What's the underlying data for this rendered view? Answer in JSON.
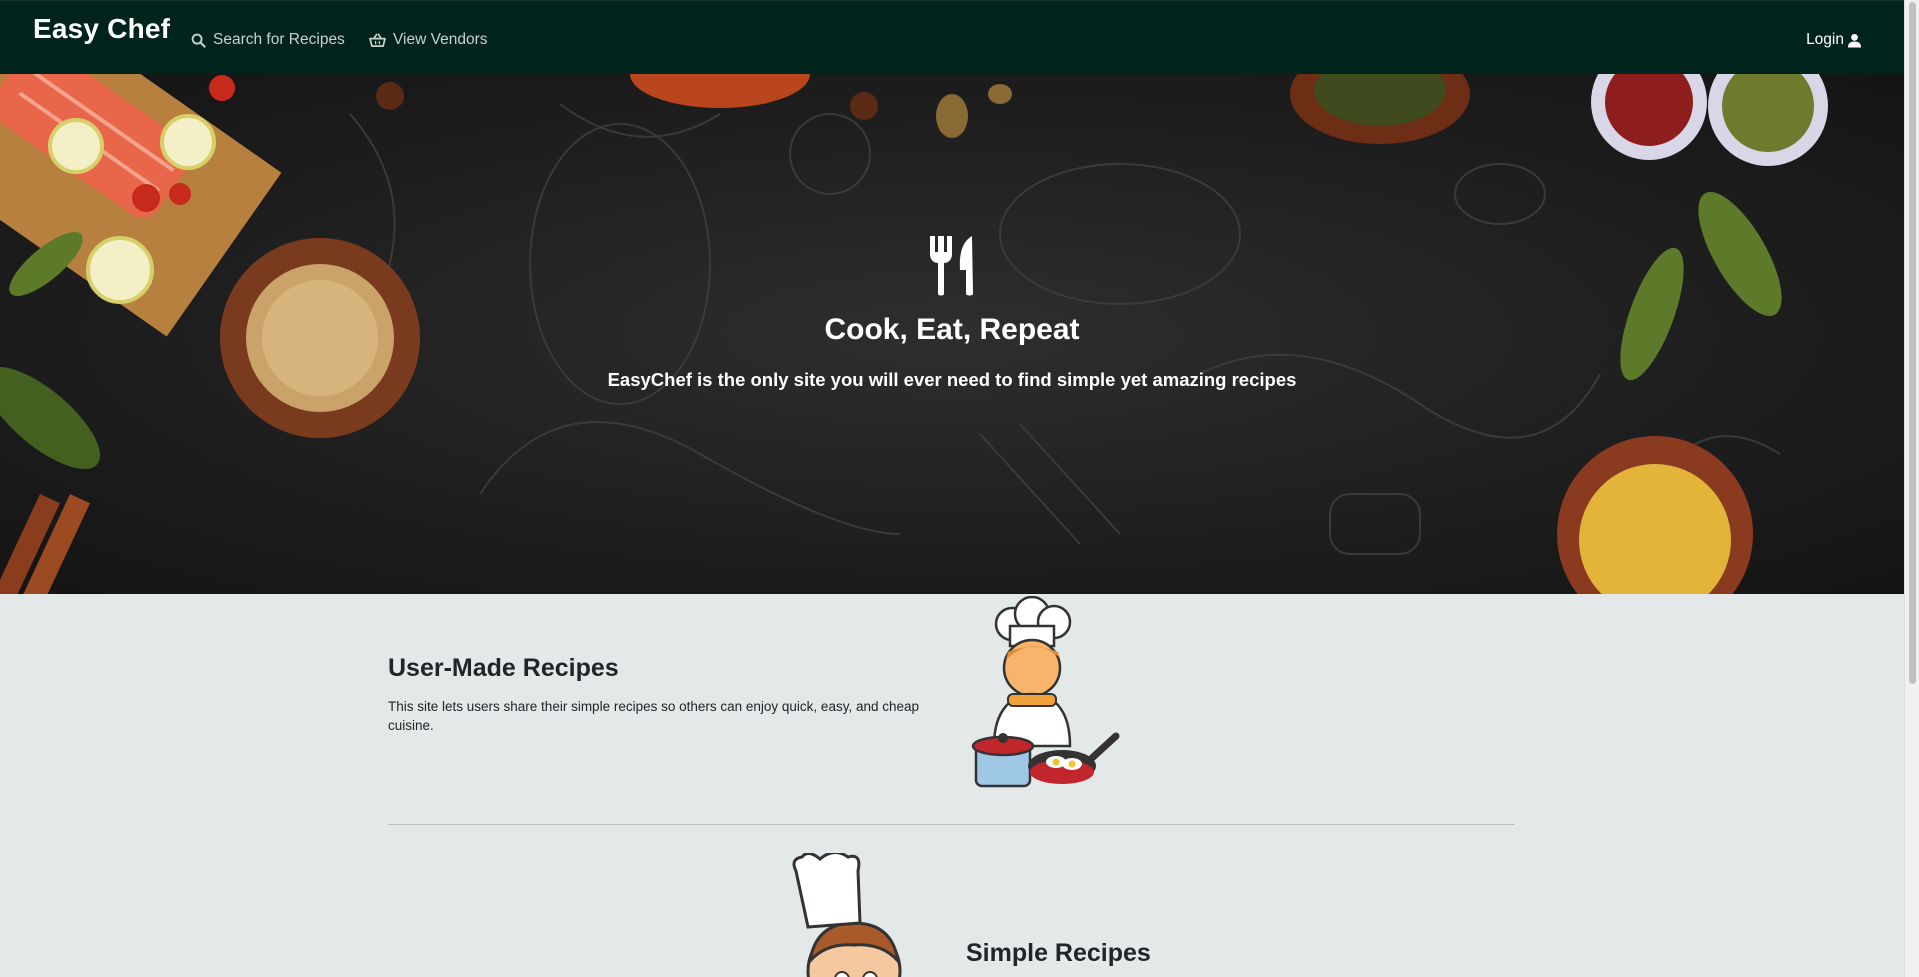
{
  "navbar": {
    "brand": "Easy Chef",
    "search_label": "Search for Recipes",
    "vendors_label": "View Vendors",
    "login_label": "Login"
  },
  "hero": {
    "title": "Cook, Eat, Repeat",
    "subtitle": "EasyChef is the only site you will ever need to find simple yet amazing recipes"
  },
  "features": [
    {
      "heading": "User-Made Recipes",
      "body": "This site lets users share their simple recipes so others can enjoy quick, easy, and cheap cuisine."
    },
    {
      "heading": "Simple Recipes"
    }
  ],
  "colors": {
    "navbar_bg": "#00241b",
    "page_bg": "#e3e8e8",
    "hero_bg": "#1f1f1f"
  }
}
